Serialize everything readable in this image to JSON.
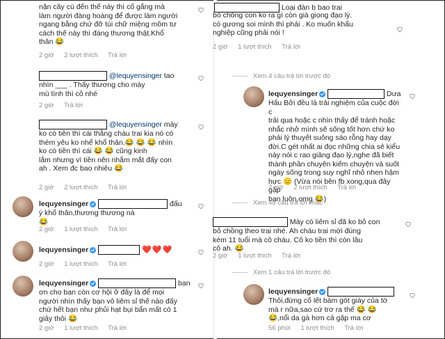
{
  "left": {
    "c1": {
      "lines": [
        "nặn cây cù đến thế này thì cố gắng mà",
        "làm người đàng hoàng để được làm người",
        "ngang bằng chứ đỡ túi chữ miệng mồm tư",
        "cách thế này thì đáng thương thật.Khổ",
        "thân 😂"
      ],
      "time": "2 giờ",
      "likes": "2 lượt thích",
      "reply": "Trả lời"
    },
    "c2": {
      "mention": "@lequyensinger",
      "after_mention": " tao",
      "lines": [
        "nhìn ___ . Thấy thương cho mày",
        "mù tình thì cỏ nhé"
      ],
      "time": "2 giờ",
      "reply": "Trả lời"
    },
    "c3": {
      "mention": "@lequyensinger",
      "after_mention": " mày",
      "lines": [
        "ko có tiền thì cái thằng cháu trai kia nó có",
        "thèm yêu ko nhể khổ thân.😂 😂 😂 nhìn",
        "ko có tiền thì cái 😂 😂 cũng kinh",
        "lắm nhưng vì tiền nên nhắm mắt đấy con",
        "ah . Xem đc bao nhiêu 😂"
      ],
      "time": "2 giờ",
      "likes": "2 lượt thích",
      "reply": "Trả lời"
    },
    "c4": {
      "user": "lequyensinger",
      "after": " đấu",
      "lines": [
        "ý khổ thân,thương thương nà",
        "😂"
      ],
      "time": "2 giờ",
      "likes": "1 lượt thích",
      "reply": "Trả lời"
    },
    "c5": {
      "user": "lequyensinger",
      "hearts": "❤️❤️❤️",
      "time": "2 giờ",
      "likes": "1 lượt thích",
      "reply": "Trả lời"
    },
    "c6": {
      "user": "lequyensinger",
      "after": " bạn",
      "lines": [
        "ơn cho bạn còn cơ hội ở đây là để mọi",
        "người nhìn thấy bạn vô liêm sỉ thế nào đấy",
        "chứ hết bạn như phủi hạt bụi bẩn mất có 1",
        "giây thôi 😂"
      ],
      "time": "2 giờ",
      "likes": "1 lượt thích",
      "reply": "Trả lời"
    }
  },
  "right": {
    "c1": {
      "after": " Loại đàn b    bao trai",
      "lines": [
        "bỏ chồng con ko ra gì còn già giọng đạo lý.",
        "     có gương soi mình thì phải . Ko muốn khẩu",
        "nghiệp cũng phải nói !"
      ],
      "time": "2 giờ",
      "likes": "1 lượt thích",
      "reply": "Trả lời"
    },
    "view1": "Xem 4 câu trả lời trước đó",
    "c2": {
      "user": "lequyensinger",
      "after": " Dưa",
      "lines": [
        "Hấu Bởi đều là trải nghiệm của cuộc đời c",
        "trải qua hoặc c nhìn thấy để tránh hoặc",
        "nhắc nhở mình sẽ sống tốt hơn chứ ko",
        "phải lý thuyết suông sáo rỗng hay dạy",
        "đời.C gét nhất ai đọc những chia sẻ kiểu",
        "này nói c rao giảng đạo lý,nghe đã biết",
        "thành phần chuyên kiếm chuyện và suốt",
        "ngày sống trong suy nghĩ nhỏ nhen hậm",
        "hực 😑 (Vừa nói bên fb xong,qua đây gặp",
        "bạn luôn,omg 😂)"
      ],
      "time": "2 giờ",
      "likes": "2 lượt thích",
      "reply": "Trả lời"
    },
    "view2": "Xem 48 câu trả lời khác",
    "c3": {
      "lines": [
        "Mày có liêm sỉ đã ko bỏ con",
        "bỏ chồng theo trai nhé. Ah cháu trai mới đúng",
        "kém 11 tuổi mà cô cháu. Cô ko tiền thì còn lâu",
        "cô ah. 😂"
      ],
      "time": "2 giờ",
      "likes": "1 lượt thích",
      "reply": "Trả lời"
    },
    "view3": "Xem 1 câu trả lời trước đó",
    "c4": {
      "user": "lequyensinger",
      "after": "",
      "lines": [
        "Thôi,đừng cố lết bám gót giày của tớ",
        "mà r        nữa,sao cứ trơ ra thế 😂 😂",
        "😂,nổi da gà hơn cả gặp ma cơ"
      ],
      "time": "56 phút",
      "likes": "1 lượt thích",
      "reply": "Trả lời"
    }
  },
  "colors": {
    "meta": "#8e8e8e",
    "text": "#262626",
    "mention": "#00376b",
    "verified": "#3897f0",
    "heart_red": "#e0245e"
  },
  "icons": {
    "like": "heart-outline-icon",
    "verified": "verified-badge-icon"
  }
}
